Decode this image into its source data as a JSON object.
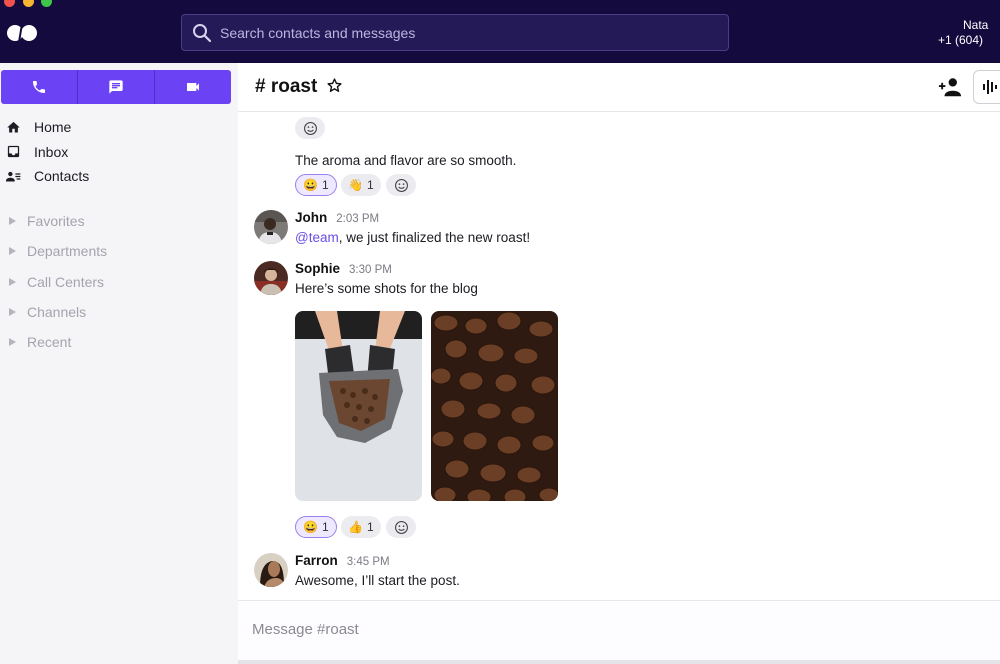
{
  "topbar": {
    "search": {
      "placeholder": "Search contacts and messages",
      "value": ""
    },
    "user": {
      "name": "Nata",
      "phone": "+1 (604)"
    }
  },
  "sidebar": {
    "actions": [
      {
        "name": "call",
        "icon": "phone-icon"
      },
      {
        "name": "message",
        "icon": "chat-icon"
      },
      {
        "name": "video",
        "icon": "video-icon"
      }
    ],
    "nav": [
      {
        "label": "Home",
        "icon": "home-icon"
      },
      {
        "label": "Inbox",
        "icon": "inbox-icon"
      },
      {
        "label": "Contacts",
        "icon": "contacts-icon"
      }
    ],
    "groups": [
      {
        "label": "Favorites"
      },
      {
        "label": "Departments"
      },
      {
        "label": "Call Centers"
      },
      {
        "label": "Channels"
      },
      {
        "label": "Recent"
      }
    ]
  },
  "channel": {
    "title": "# roast",
    "colors": {
      "accent": "#6b43f5",
      "mention": "#6b4ee6",
      "topbar": "#140a3e"
    }
  },
  "messages": [
    {
      "text": "The aroma and flavor are so smooth.",
      "reactions": [
        {
          "emoji": "😀",
          "count": "1",
          "active": true
        },
        {
          "emoji": "👋",
          "count": "1",
          "active": false
        }
      ]
    },
    {
      "author": "John",
      "time": "2:03 PM",
      "mention": "@team",
      "text": ", we just finalized the new roast!"
    },
    {
      "author": "Sophie",
      "time": "3:30 PM",
      "text": "Here’s some shots for the blog",
      "images": [
        "coffee bag with gloved hands",
        "roasted coffee beans"
      ],
      "reactions": [
        {
          "emoji": "😀",
          "count": "1",
          "active": true
        },
        {
          "emoji": "👍",
          "count": "1",
          "active": false
        }
      ]
    },
    {
      "author": "Farron",
      "time": "3:45 PM",
      "text": "Awesome, I’ll start the post."
    }
  ],
  "composer": {
    "placeholder": "Message #roast",
    "value": ""
  }
}
